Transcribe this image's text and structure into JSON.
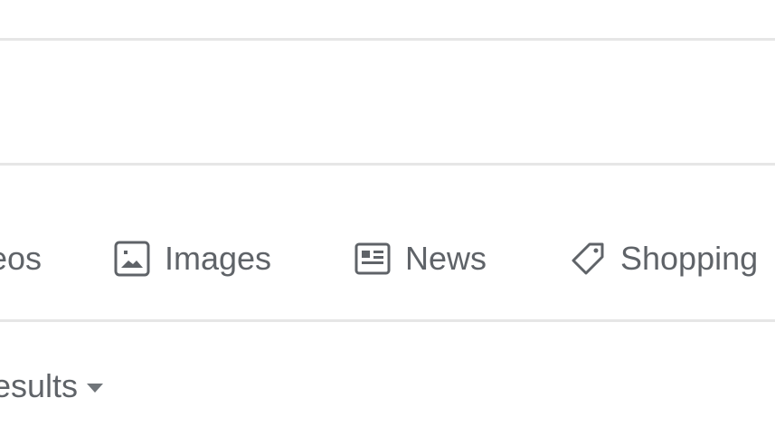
{
  "search_area": {},
  "tabs": [
    {
      "label": "eos",
      "icon": "video-icon"
    },
    {
      "label": "Images",
      "icon": "image-icon"
    },
    {
      "label": "News",
      "icon": "news-icon"
    },
    {
      "label": "Shopping",
      "icon": "tag-icon"
    }
  ],
  "results_filter": {
    "label": "esults",
    "icon": "caret-down-icon"
  },
  "colors": {
    "text": "#5f6368",
    "divider": "#e6e6e6",
    "background": "#ffffff"
  }
}
